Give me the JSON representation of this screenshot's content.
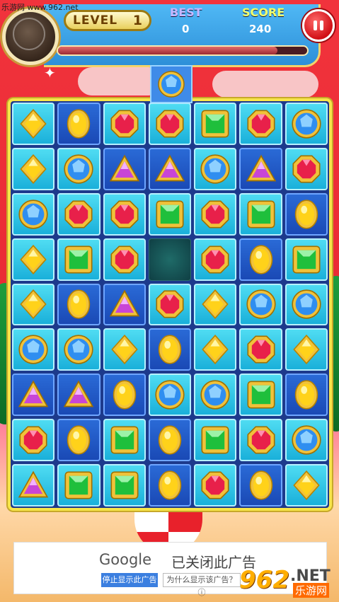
{
  "watermark_top": "乐游网 www.962.net",
  "header": {
    "level_label": "LEVEL",
    "level_value": "1",
    "best_label": "BEST",
    "best_value": "0",
    "score_label": "SCORE",
    "score_value": "240",
    "progress_fraction": 0.88
  },
  "board": {
    "incoming_gem": "blue",
    "rows": [
      [
        "yellow-diamond",
        "yellow-oval",
        "red-octagon",
        "red-octagon",
        "green-square",
        "red-octagon",
        "blue-round"
      ],
      [
        "yellow-diamond",
        "blue-round",
        "purple-triangle",
        "purple-triangle",
        "blue-round",
        "purple-triangle",
        "red-octagon"
      ],
      [
        "blue-round",
        "red-octagon",
        "red-octagon",
        "green-square",
        "red-octagon",
        "green-square",
        "yellow-oval"
      ],
      [
        "yellow-diamond",
        "green-square",
        "red-octagon",
        "empty",
        "red-octagon",
        "yellow-oval",
        "green-square"
      ],
      [
        "yellow-diamond",
        "yellow-oval",
        "purple-triangle",
        "red-octagon",
        "yellow-diamond",
        "blue-round",
        "blue-round"
      ],
      [
        "blue-round",
        "blue-round",
        "yellow-diamond",
        "yellow-oval",
        "yellow-diamond",
        "red-octagon",
        "yellow-diamond"
      ],
      [
        "purple-triangle",
        "purple-triangle",
        "yellow-oval",
        "blue-round",
        "blue-round",
        "green-square",
        "yellow-oval"
      ],
      [
        "red-octagon",
        "yellow-oval",
        "green-square",
        "yellow-oval",
        "green-square",
        "red-octagon",
        "blue-round"
      ],
      [
        "purple-triangle",
        "green-square",
        "green-square",
        "yellow-oval",
        "red-octagon",
        "yellow-oval",
        "yellow-diamond"
      ]
    ],
    "shades": [
      [
        "light",
        "dark",
        "light",
        "light",
        "light",
        "light",
        "light"
      ],
      [
        "light",
        "light",
        "dark",
        "dark",
        "light",
        "dark",
        "light"
      ],
      [
        "light",
        "light",
        "light",
        "light",
        "light",
        "light",
        "dark"
      ],
      [
        "light",
        "light",
        "light",
        "empty",
        "light",
        "dark",
        "light"
      ],
      [
        "light",
        "dark",
        "dark",
        "light",
        "light",
        "light",
        "light"
      ],
      [
        "light",
        "light",
        "light",
        "dark",
        "light",
        "light",
        "light"
      ],
      [
        "dark",
        "dark",
        "dark",
        "light",
        "light",
        "light",
        "dark"
      ],
      [
        "light",
        "dark",
        "light",
        "dark",
        "light",
        "light",
        "light"
      ],
      [
        "light",
        "light",
        "light",
        "dark",
        "light",
        "dark",
        "light"
      ]
    ]
  },
  "ad": {
    "google_label": "Google",
    "closed_text": "已关闭此广告",
    "stop_button": "停止显示此广告",
    "why_button": "为什么显示该广告？ⓘ"
  },
  "watermark_logo": {
    "number": "962",
    "suffix": ".NET",
    "cn": "乐游网"
  },
  "colors": {
    "red": "#e8204a",
    "yellow": "#ffd21a",
    "blue": "#2f8ef0",
    "green": "#1fbf3c",
    "purple": "#c845d6"
  }
}
